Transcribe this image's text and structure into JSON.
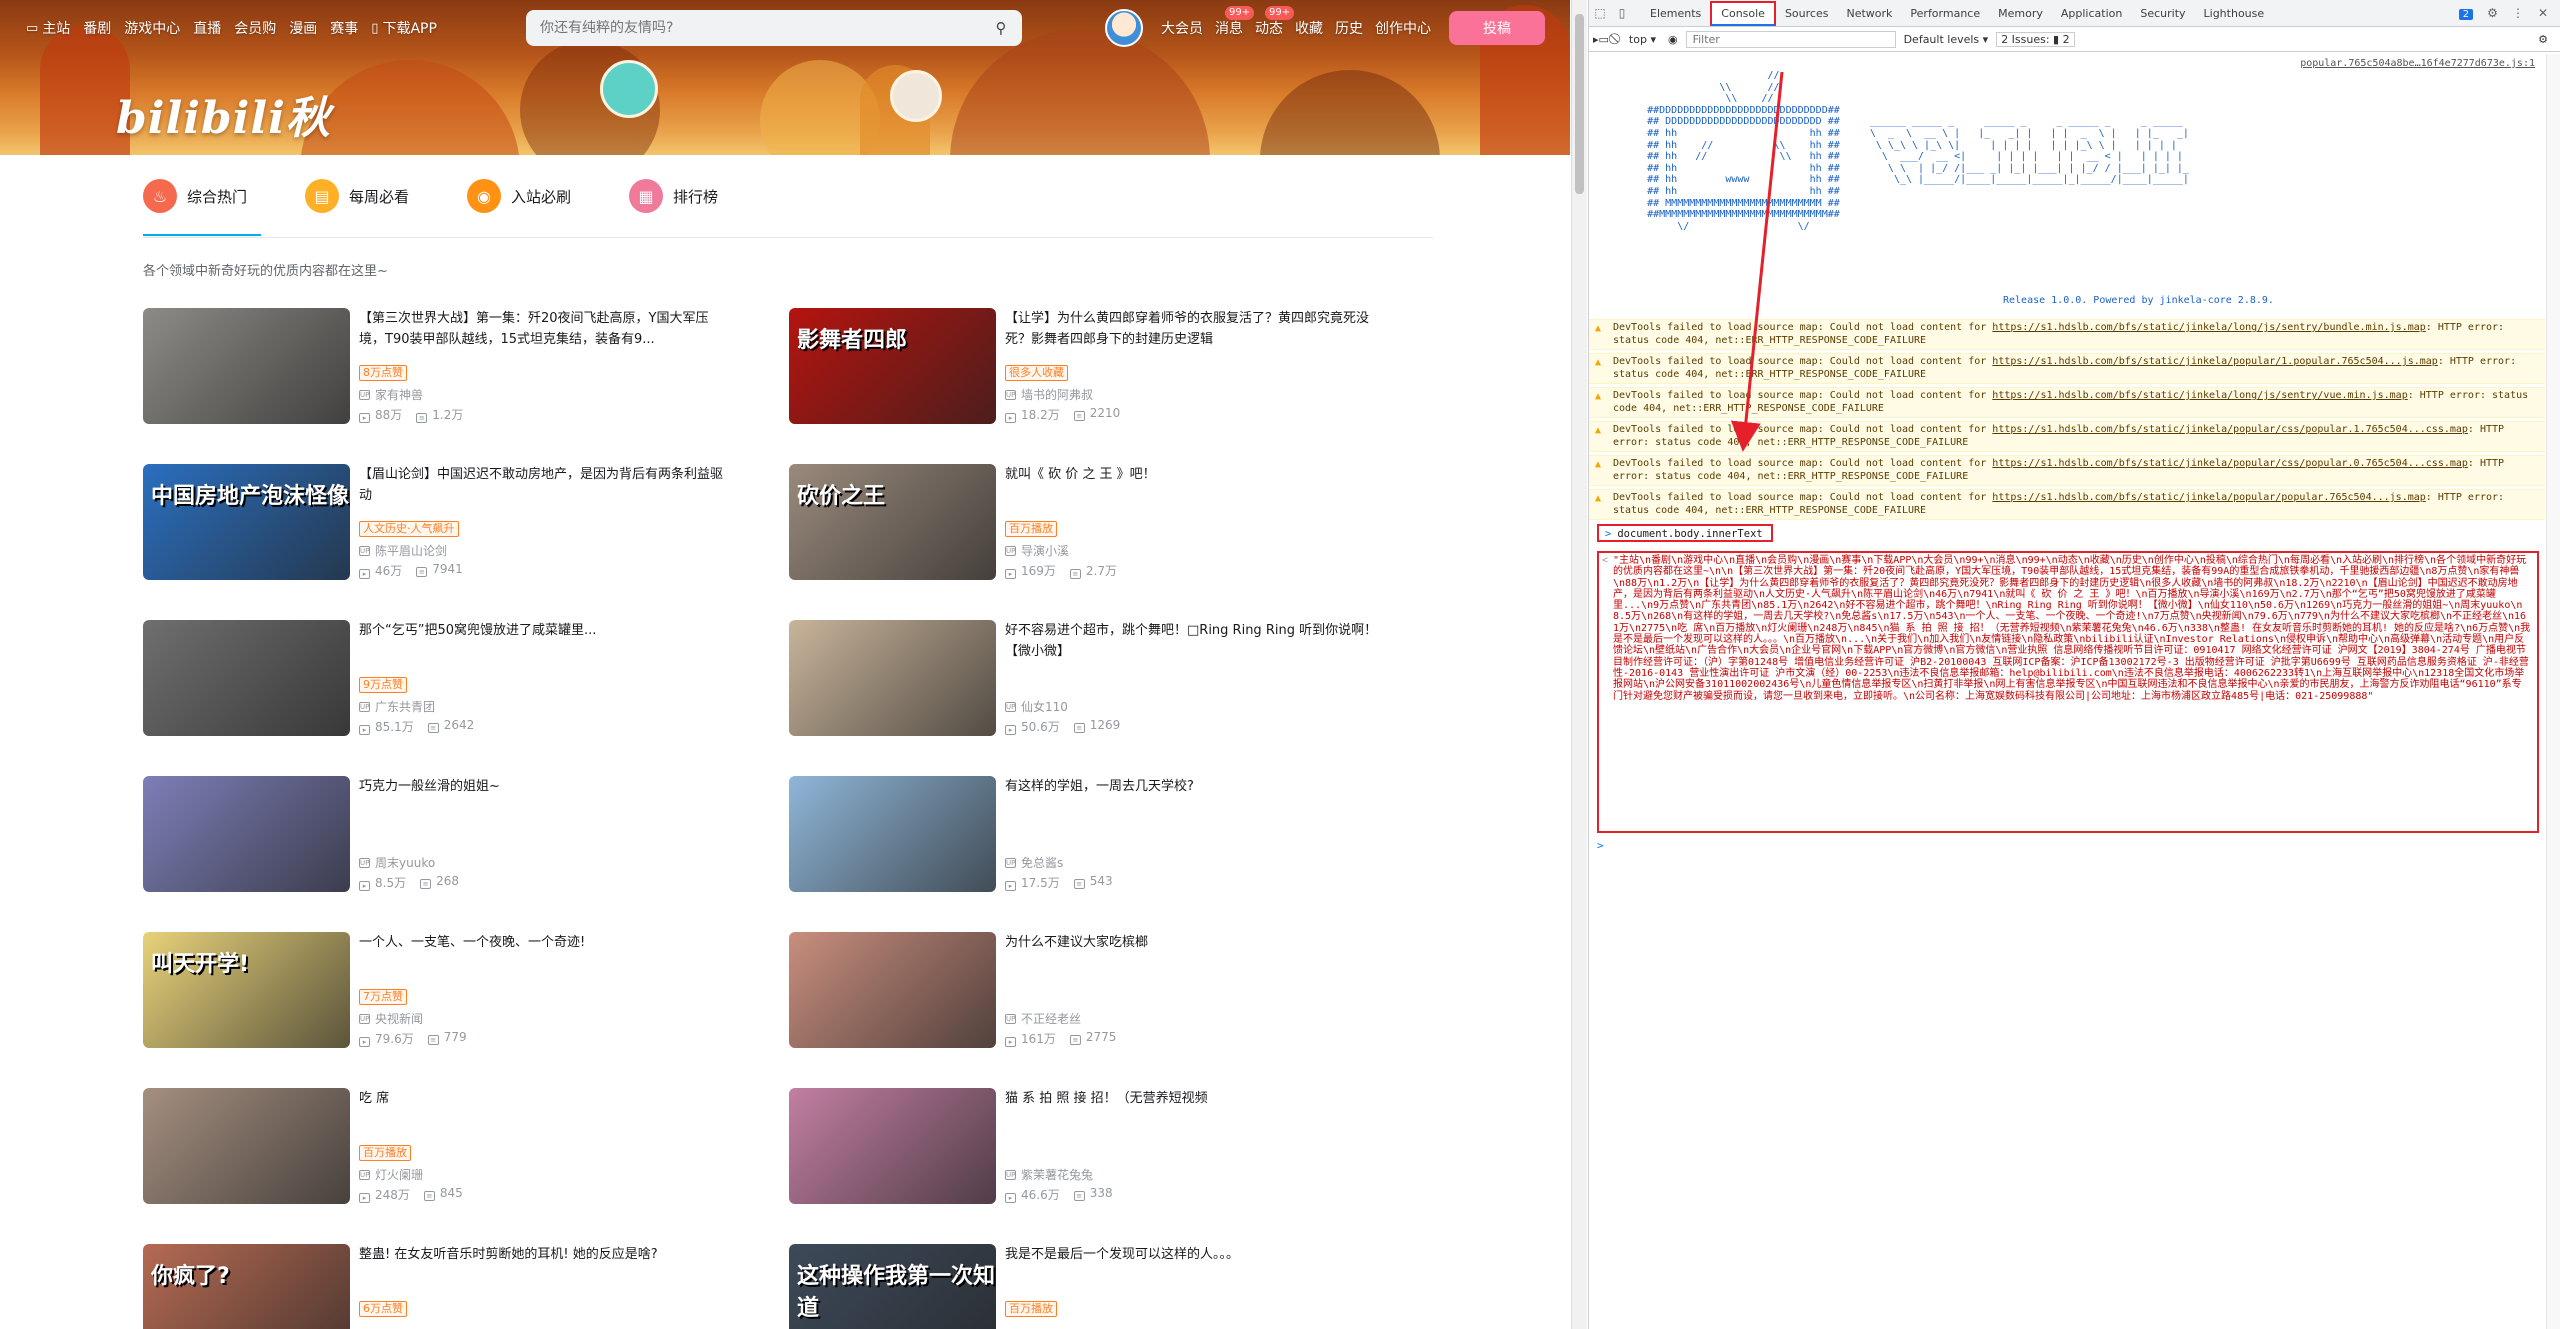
{
  "header": {
    "nav_left": [
      {
        "icon": "tv-icon",
        "glyph": "▭",
        "label": "主站"
      },
      {
        "icon": "",
        "glyph": "",
        "label": "番剧"
      },
      {
        "icon": "",
        "glyph": "",
        "label": "游戏中心"
      },
      {
        "icon": "",
        "glyph": "",
        "label": "直播"
      },
      {
        "icon": "",
        "glyph": "",
        "label": "会员购"
      },
      {
        "icon": "",
        "glyph": "",
        "label": "漫画"
      },
      {
        "icon": "",
        "glyph": "",
        "label": "赛事"
      },
      {
        "icon": "phone-icon",
        "glyph": "▯",
        "label": "下载APP"
      }
    ],
    "search_placeholder": "你还有纯粹的友情吗?",
    "nav_right": [
      {
        "label": "大会员",
        "badge": ""
      },
      {
        "label": "消息",
        "badge": "99+"
      },
      {
        "label": "动态",
        "badge": "99+"
      },
      {
        "label": "收藏",
        "badge": ""
      },
      {
        "label": "历史",
        "badge": ""
      },
      {
        "label": "创作中心",
        "badge": ""
      }
    ],
    "upload_label": "投稿",
    "logo_text": "bilibili秋",
    "brand_color": "#fb7299"
  },
  "tabs": [
    {
      "label": "综合热门",
      "icon": "flame-icon",
      "glyph": "♨",
      "color": "#f5694f"
    },
    {
      "label": "每周必看",
      "icon": "calendar-icon",
      "glyph": "▤",
      "color": "#ffb027"
    },
    {
      "label": "入站必刷",
      "icon": "medal-icon",
      "glyph": "◉",
      "color": "#ff9212"
    },
    {
      "label": "排行榜",
      "icon": "rank-icon",
      "glyph": "▦",
      "color": "#f07a9a"
    }
  ],
  "subtitle": "各个领域中新奇好玩的优质内容都在这里~",
  "videos": [
    {
      "title": "【第三次世界大战】第一集：歼20夜间飞赴高原，Y国大军压境，T90装甲部队越线，15式坦克集结，装备有9...",
      "tag": "8万点赞",
      "up": "家有神兽",
      "plays": "88万",
      "danmaku": "1.2万",
      "thumb": "#8d8b86",
      "caption": ""
    },
    {
      "title": "【让学】为什么黄四郎穿着师爷的衣服复活了？黄四郎究竟死没死？影舞者四郎身下的封建历史逻辑",
      "tag": "很多人收藏",
      "up": "墙书的阿弗叔",
      "plays": "18.2万",
      "danmaku": "2210",
      "thumb": "#b5140f",
      "caption": "影舞者四郎"
    },
    {
      "title": "【眉山论剑】中国迟迟不敢动房地产，是因为背后有两条利益驱动",
      "tag": "人文历史·人气飙升",
      "up": "陈平眉山论剑",
      "plays": "46万",
      "danmaku": "7941",
      "thumb": "#2b6fbf",
      "caption": "中国房地产泡沫怪像"
    },
    {
      "title": "就叫《 砍 价 之 王 》吧！",
      "tag": "百万播放",
      "up": "导演小溪",
      "plays": "169万",
      "danmaku": "2.7万",
      "thumb": "#9a8a7c",
      "caption": "砍价之王"
    },
    {
      "title": "那个“乞丐”把50窝兜馒放进了咸菜罐里...",
      "tag": "9万点赞",
      "up": "广东共青团",
      "plays": "85.1万",
      "danmaku": "2642",
      "thumb": "#6f6f6f",
      "caption": ""
    },
    {
      "title": "好不容易进个超市，跳个舞吧！□Ring Ring Ring 听到你说啊！【微小微】",
      "tag": "",
      "up": "仙女110",
      "plays": "50.6万",
      "danmaku": "1269",
      "thumb": "#c9b49a",
      "caption": ""
    },
    {
      "title": "巧克力一般丝滑的姐姐~",
      "tag": "",
      "up": "周末yuuko",
      "plays": "8.5万",
      "danmaku": "268",
      "thumb": "#7d7fb8",
      "caption": ""
    },
    {
      "title": "有这样的学姐，一周去几天学校?",
      "tag": "",
      "up": "免总酱s",
      "plays": "17.5万",
      "danmaku": "543",
      "thumb": "#8fb6d8",
      "caption": ""
    },
    {
      "title": "一个人、一支笔、一个夜晚、一个奇迹!",
      "tag": "7万点赞",
      "up": "央视新闻",
      "plays": "79.6万",
      "danmaku": "779",
      "thumb": "#e8d27a",
      "caption": "叫天开学!"
    },
    {
      "title": "为什么不建议大家吃槟榔",
      "tag": "",
      "up": "不正经老丝",
      "plays": "161万",
      "danmaku": "2775",
      "thumb": "#c98e7e",
      "caption": ""
    },
    {
      "title": "吃 席",
      "tag": "百万播放",
      "up": "灯火阑珊",
      "plays": "248万",
      "danmaku": "845",
      "thumb": "#a58f80",
      "caption": ""
    },
    {
      "title": "猫 系 拍 照 接 招！（无营养短视频",
      "tag": "",
      "up": "紫茉薯花兔兔",
      "plays": "46.6万",
      "danmaku": "338",
      "thumb": "#c37fa2",
      "caption": ""
    },
    {
      "title": "整蛊! 在女友听音乐时剪断她的耳机! 她的反应是啥?",
      "tag": "6万点赞",
      "up": "",
      "plays": "",
      "danmaku": "",
      "thumb": "#b56a52",
      "caption": "你疯了?"
    },
    {
      "title": "我是不是最后一个发现可以这样的人。。。",
      "tag": "百万播放",
      "up": "",
      "plays": "",
      "danmaku": "",
      "thumb": "#3d4a5a",
      "caption": "这种操作我第一次知道"
    }
  ],
  "devtools": {
    "tabs": [
      "Elements",
      "Console",
      "Sources",
      "Network",
      "Performance",
      "Memory",
      "Application",
      "Security",
      "Lighthouse"
    ],
    "active_tab": "Console",
    "issues_badge": "2",
    "context": "top ▾",
    "filter_placeholder": "Filter",
    "levels": "Default levels ▾",
    "issues_count": "2 Issues: ▮ 2",
    "source_link": "popular.765c504a8be…16f4e7277d673e.js:1",
    "release_text": "Release 1.0.0. Powered by jinkela-core 2.8.9.",
    "warnings": [
      {
        "text": "DevTools failed to load source map: Could not load content for ",
        "url": "https://s1.hdslb.com/bfs/static/jinkela/long/js/sentry/bundle.min.js.map",
        "tail": ": HTTP error: status code 404, net::ERR_HTTP_RESPONSE_CODE_FAILURE"
      },
      {
        "text": "DevTools failed to load source map: Could not load content for ",
        "url": "https://s1.hdslb.com/bfs/static/jinkela/popular/1.popular.765c504...js.map",
        "tail": ": HTTP error: status code 404, net::ERR_HTTP_RESPONSE_CODE_FAILURE"
      },
      {
        "text": "DevTools failed to load source map: Could not load content for ",
        "url": "https://s1.hdslb.com/bfs/static/jinkela/long/js/sentry/vue.min.js.map",
        "tail": ": HTTP error: status code 404, net::ERR_HTTP_RESPONSE_CODE_FAILURE"
      },
      {
        "text": "DevTools failed to load source map: Could not load content for ",
        "url": "https://s1.hdslb.com/bfs/static/jinkela/popular/css/popular.1.765c504...css.map",
        "tail": ": HTTP error: status code 404, net::ERR_HTTP_RESPONSE_CODE_FAILURE"
      },
      {
        "text": "DevTools failed to load source map: Could not load content for ",
        "url": "https://s1.hdslb.com/bfs/static/jinkela/popular/css/popular.0.765c504...css.map",
        "tail": ": HTTP error: status code 404, net::ERR_HTTP_RESPONSE_CODE_FAILURE"
      },
      {
        "text": "DevTools failed to load source map: Could not load content for ",
        "url": "https://s1.hdslb.com/bfs/static/jinkela/popular/popular.765c504...js.map",
        "tail": ": HTTP error: status code 404, net::ERR_HTTP_RESPONSE_CODE_FAILURE"
      }
    ],
    "command": "document.body.innerText",
    "result_text": "\"主站\\n番剧\\n游戏中心\\n直播\\n会员购\\n漫画\\n赛事\\n下载APP\\n大会员\\n99+\\n消息\\n99+\\n动态\\n收藏\\n历史\\n创作中心\\n投稿\\n综合热门\\n每周必看\\n入站必刷\\n排行榜\\n各个领域中新奇好玩的优质内容都在这里~\\n\\n【第三次世界大战】第一集：歼20夜间飞赴高原，Y国大军压境，T90装甲部队越线，15式坦克集结，装备有99A的重型合成旅铁拳机动，千里驰援西部边疆\\n8万点赞\\n家有神兽\\n88万\\n1.2万\\n【让学】为什么黄四郎穿着师爷的衣服复活了？黄四郎究竟死没死？影舞者四郎身下的封建历史逻辑\\n很多人收藏\\n墙书的阿弗叔\\n18.2万\\n2210\\n【眉山论剑】中国迟迟不敢动房地产，是因为背后有两条利益驱动\\n人文历史·人气飙升\\n陈平眉山论剑\\n46万\\n7941\\n就叫《 砍 价 之 王 》吧！\\n百万播放\\n导演小溪\\n169万\\n2.7万\\n那个“乞丐”把50窝兜馒放进了咸菜罐里...\\n9万点赞\\n广东共青团\\n85.1万\\n2642\\n好不容易进个超市，跳个舞吧！\\nRing Ring Ring 听到你说啊！【微小微】\\n仙女110\\n50.6万\\n1269\\n巧克力一般丝滑的姐姐~\\n周末yuuko\\n8.5万\\n268\\n有这样的学姐，一周去几天学校?\\n免总酱s\\n17.5万\\n543\\n一个人、一支笔、一个夜晚、一个奇迹!\\n7万点赞\\n央视新闻\\n79.6万\\n779\\n为什么不建议大家吃槟榔\\n不正经老丝\\n161万\\n2775\\n吃 席\\n百万播放\\n灯火阑珊\\n248万\\n845\\n猫 系 拍 照 接 招！（无营养短视频\\n紫茉薯花兔兔\\n46.6万\\n338\\n整蛊! 在女友听音乐时剪断她的耳机! 她的反应是啥?\\n6万点赞\\n我是不是最后一个发现可以这样的人。。。\\n百万播放\\n...\\n关于我们\\n加入我们\\n友情链接\\n隐私政策\\nbilibili认证\\nInvestor Relations\\n侵权申诉\\n帮助中心\\n高级弹幕\\n活动专题\\n用户反馈论坛\\n壁纸站\\n广告合作\\n大会员\\n企业号官网\\n下载APP\\n官方微博\\n官方微信\\n营业执照 信息网络传播视听节目许可证：0910417 网络文化经营许可证 沪网文【2019】3804-274号 广播电视节目制作经营许可证：（沪）字第01248号 增值电信业务经营许可证 沪B2-20100043 互联网ICP备案：沪ICP备13002172号-3 出版物经营许可证 沪批字第U6699号 互联网药品信息服务资格证 沪-非经营性-2016-0143 营业性演出许可证 沪市文演（经）00-2253\\n违法不良信息举报邮箱：help@bilibili.com\\n违法不良信息举报电话：4006262233转1\\n上海互联网举报中心\\n12318全国文化市场举报网站\\n沪公网安备31011002002436号\\n儿童色情信息举报专区\\n扫黄打非举报\\n网上有害信息举报专区\\n中国互联网违法和不良信息举报中心\\n亲爱的市民朋友，上海警方反诈劝阻电话“96110”系专门针对避免您财产被骗受损而设，请您一旦收到来电，立即接听。\\n公司名称：上海宽娱数码科技有限公司|公司地址：上海市杨浦区政立路485号|电话：021-25099888\""
  }
}
